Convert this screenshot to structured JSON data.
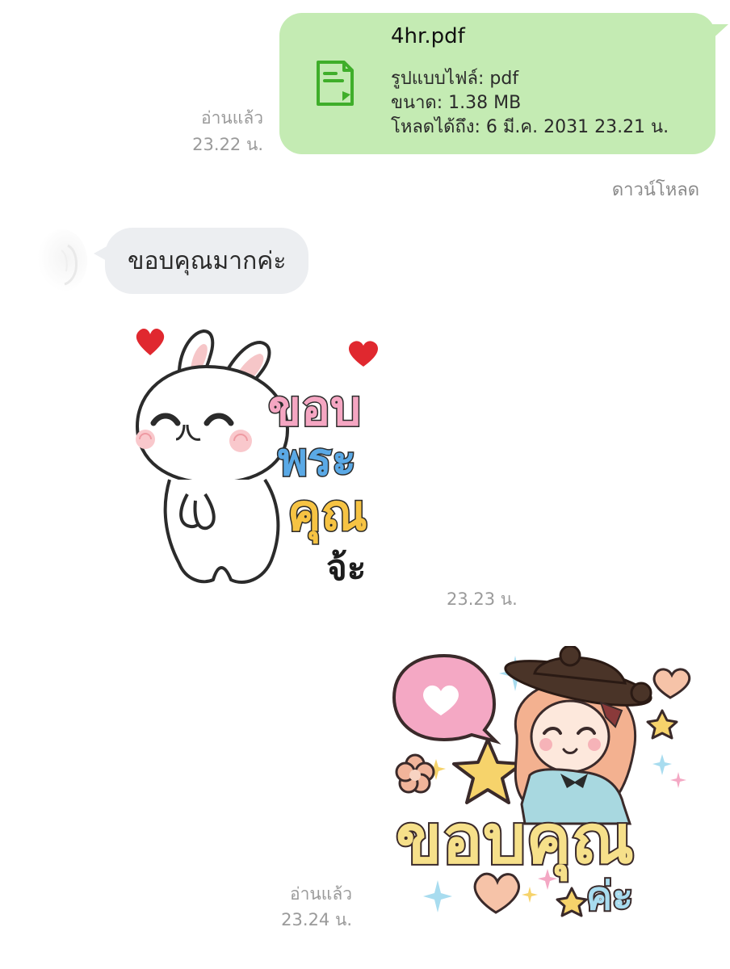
{
  "messages": {
    "file_message": {
      "icon": "document-icon",
      "file_name": "4hr.pdf",
      "type_line": "รูปแบบไฟล์: pdf",
      "size_line": "ขนาด: 1.38 MB",
      "expiry_line": "โหลดได้ถึง: 6 มี.ค. 2031 23.21 น.",
      "read_label": "อ่านแล้ว",
      "time": "23.22 น.",
      "download_label": "ดาวน์โหลด",
      "bubble_color": "#c4ebb3"
    },
    "incoming_text": {
      "text": "ขอบคุณมากค่ะ",
      "bubble_color": "#eceef1"
    },
    "incoming_sticker": {
      "sticker": "rabbit-thank-you-sticker",
      "lines": [
        "ขอบ",
        "พระ",
        "คุณ",
        "จ้ะ"
      ],
      "time": "23.23 น."
    },
    "outgoing_sticker": {
      "sticker": "girl-thank-you-sticker",
      "lines": [
        "ขอบคุณ",
        "ค่ะ"
      ],
      "read_label": "อ่านแล้ว",
      "time": "23.24 น."
    }
  },
  "colors": {
    "meta_text": "#9a9a9a",
    "file_icon_green": "#3fae2a"
  }
}
